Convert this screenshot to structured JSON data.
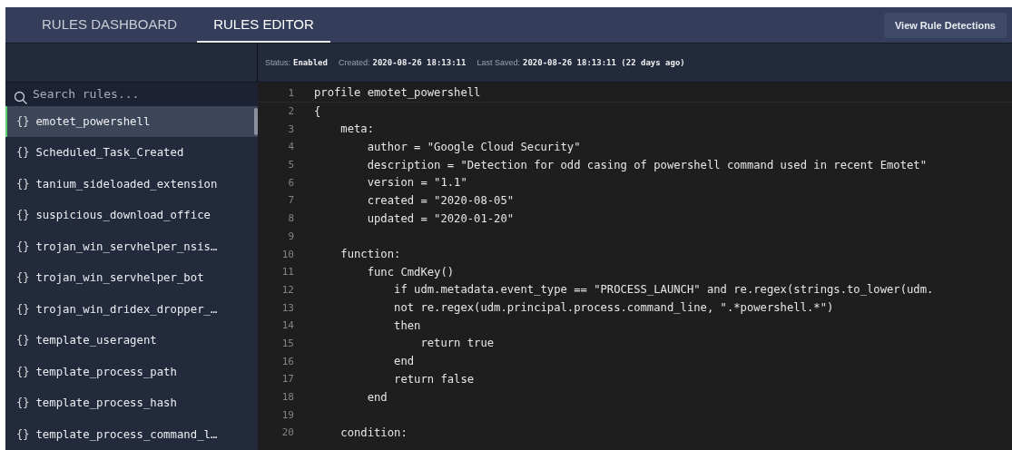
{
  "tabs": [
    {
      "label": "RULES DASHBOARD",
      "selected": false
    },
    {
      "label": "RULES EDITOR",
      "selected": true
    }
  ],
  "header_button": "View Rule Detections",
  "status_bar": [
    {
      "label": "Status:",
      "value": "Enabled"
    },
    {
      "label": "Created:",
      "value": "2020-08-26 18:13:11"
    },
    {
      "label": "Last Saved:",
      "value": "2020-08-26 18:13:11 (22 days ago)"
    }
  ],
  "sidebar": {
    "search": {
      "placeholder": "Search rules..."
    },
    "items": [
      {
        "icon_glyph": "{}",
        "name": "emotet_powershell",
        "selected": true
      },
      {
        "icon_glyph": "{}",
        "name": "Scheduled_Task_Created",
        "selected": false
      },
      {
        "icon_glyph": "{}",
        "name": "tanium_sideloaded_extension",
        "selected": false
      },
      {
        "icon_glyph": "{}",
        "name": "suspicious_download_office",
        "selected": false
      },
      {
        "icon_glyph": "{}",
        "name": "trojan_win_servhelper_nsis…",
        "selected": false
      },
      {
        "icon_glyph": "{}",
        "name": "trojan_win_servhelper_bot",
        "selected": false
      },
      {
        "icon_glyph": "{}",
        "name": "trojan_win_dridex_dropper_…",
        "selected": false
      },
      {
        "icon_glyph": "{}",
        "name": "template_useragent",
        "selected": false
      },
      {
        "icon_glyph": "{}",
        "name": "template_process_path",
        "selected": false
      },
      {
        "icon_glyph": "{}",
        "name": "template_process_hash",
        "selected": false
      },
      {
        "icon_glyph": "{}",
        "name": "template_process_command_l…",
        "selected": false
      }
    ]
  },
  "editor": {
    "lines": [
      {
        "number": "1",
        "text": "profile emotet_powershell"
      },
      {
        "number": "2",
        "text": "{"
      },
      {
        "number": "3",
        "text": "    meta:"
      },
      {
        "number": "4",
        "text": "        author = \"Google Cloud Security\""
      },
      {
        "number": "5",
        "text": "        description = \"Detection for odd casing of powershell command used in recent Emotet\""
      },
      {
        "number": "6",
        "text": "        version = \"1.1\""
      },
      {
        "number": "7",
        "text": "        created = \"2020-08-05\""
      },
      {
        "number": "8",
        "text": "        updated = \"2020-01-20\""
      },
      {
        "number": "9"
      },
      {
        "number": "10",
        "text": "    function:"
      },
      {
        "number": "11",
        "text": "        func CmdKey()"
      },
      {
        "number": "12",
        "text": "            if udm.metadata.event_type == \"PROCESS_LAUNCH\" and re.regex(strings.to_lower(udm."
      },
      {
        "number": "13",
        "text": "            not re.regex(udm.principal.process.command_line, \".*powershell.*\")"
      },
      {
        "number": "14",
        "text": "            then"
      },
      {
        "number": "15",
        "text": "                return true"
      },
      {
        "number": "16",
        "text": "            end"
      },
      {
        "number": "17",
        "text": "            return false"
      },
      {
        "number": "18",
        "text": "        end"
      },
      {
        "number": "19"
      },
      {
        "number": "20",
        "text": "    condition:"
      }
    ]
  }
}
